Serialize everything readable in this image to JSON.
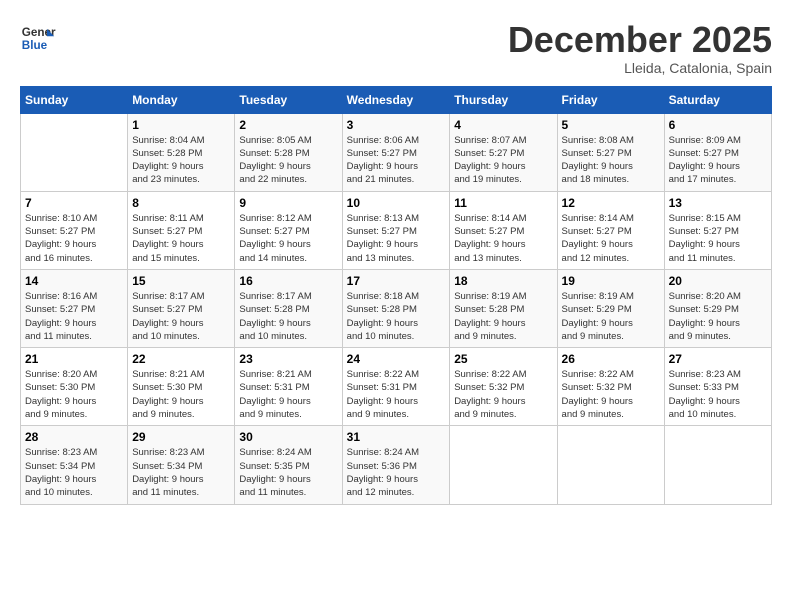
{
  "header": {
    "logo_line1": "General",
    "logo_line2": "Blue",
    "month": "December 2025",
    "location": "Lleida, Catalonia, Spain"
  },
  "weekdays": [
    "Sunday",
    "Monday",
    "Tuesday",
    "Wednesday",
    "Thursday",
    "Friday",
    "Saturday"
  ],
  "weeks": [
    [
      {
        "day": "",
        "info": ""
      },
      {
        "day": "1",
        "info": "Sunrise: 8:04 AM\nSunset: 5:28 PM\nDaylight: 9 hours\nand 23 minutes."
      },
      {
        "day": "2",
        "info": "Sunrise: 8:05 AM\nSunset: 5:28 PM\nDaylight: 9 hours\nand 22 minutes."
      },
      {
        "day": "3",
        "info": "Sunrise: 8:06 AM\nSunset: 5:27 PM\nDaylight: 9 hours\nand 21 minutes."
      },
      {
        "day": "4",
        "info": "Sunrise: 8:07 AM\nSunset: 5:27 PM\nDaylight: 9 hours\nand 19 minutes."
      },
      {
        "day": "5",
        "info": "Sunrise: 8:08 AM\nSunset: 5:27 PM\nDaylight: 9 hours\nand 18 minutes."
      },
      {
        "day": "6",
        "info": "Sunrise: 8:09 AM\nSunset: 5:27 PM\nDaylight: 9 hours\nand 17 minutes."
      }
    ],
    [
      {
        "day": "7",
        "info": "Sunrise: 8:10 AM\nSunset: 5:27 PM\nDaylight: 9 hours\nand 16 minutes."
      },
      {
        "day": "8",
        "info": "Sunrise: 8:11 AM\nSunset: 5:27 PM\nDaylight: 9 hours\nand 15 minutes."
      },
      {
        "day": "9",
        "info": "Sunrise: 8:12 AM\nSunset: 5:27 PM\nDaylight: 9 hours\nand 14 minutes."
      },
      {
        "day": "10",
        "info": "Sunrise: 8:13 AM\nSunset: 5:27 PM\nDaylight: 9 hours\nand 13 minutes."
      },
      {
        "day": "11",
        "info": "Sunrise: 8:14 AM\nSunset: 5:27 PM\nDaylight: 9 hours\nand 13 minutes."
      },
      {
        "day": "12",
        "info": "Sunrise: 8:14 AM\nSunset: 5:27 PM\nDaylight: 9 hours\nand 12 minutes."
      },
      {
        "day": "13",
        "info": "Sunrise: 8:15 AM\nSunset: 5:27 PM\nDaylight: 9 hours\nand 11 minutes."
      }
    ],
    [
      {
        "day": "14",
        "info": "Sunrise: 8:16 AM\nSunset: 5:27 PM\nDaylight: 9 hours\nand 11 minutes."
      },
      {
        "day": "15",
        "info": "Sunrise: 8:17 AM\nSunset: 5:27 PM\nDaylight: 9 hours\nand 10 minutes."
      },
      {
        "day": "16",
        "info": "Sunrise: 8:17 AM\nSunset: 5:28 PM\nDaylight: 9 hours\nand 10 minutes."
      },
      {
        "day": "17",
        "info": "Sunrise: 8:18 AM\nSunset: 5:28 PM\nDaylight: 9 hours\nand 10 minutes."
      },
      {
        "day": "18",
        "info": "Sunrise: 8:19 AM\nSunset: 5:28 PM\nDaylight: 9 hours\nand 9 minutes."
      },
      {
        "day": "19",
        "info": "Sunrise: 8:19 AM\nSunset: 5:29 PM\nDaylight: 9 hours\nand 9 minutes."
      },
      {
        "day": "20",
        "info": "Sunrise: 8:20 AM\nSunset: 5:29 PM\nDaylight: 9 hours\nand 9 minutes."
      }
    ],
    [
      {
        "day": "21",
        "info": "Sunrise: 8:20 AM\nSunset: 5:30 PM\nDaylight: 9 hours\nand 9 minutes."
      },
      {
        "day": "22",
        "info": "Sunrise: 8:21 AM\nSunset: 5:30 PM\nDaylight: 9 hours\nand 9 minutes."
      },
      {
        "day": "23",
        "info": "Sunrise: 8:21 AM\nSunset: 5:31 PM\nDaylight: 9 hours\nand 9 minutes."
      },
      {
        "day": "24",
        "info": "Sunrise: 8:22 AM\nSunset: 5:31 PM\nDaylight: 9 hours\nand 9 minutes."
      },
      {
        "day": "25",
        "info": "Sunrise: 8:22 AM\nSunset: 5:32 PM\nDaylight: 9 hours\nand 9 minutes."
      },
      {
        "day": "26",
        "info": "Sunrise: 8:22 AM\nSunset: 5:32 PM\nDaylight: 9 hours\nand 9 minutes."
      },
      {
        "day": "27",
        "info": "Sunrise: 8:23 AM\nSunset: 5:33 PM\nDaylight: 9 hours\nand 10 minutes."
      }
    ],
    [
      {
        "day": "28",
        "info": "Sunrise: 8:23 AM\nSunset: 5:34 PM\nDaylight: 9 hours\nand 10 minutes."
      },
      {
        "day": "29",
        "info": "Sunrise: 8:23 AM\nSunset: 5:34 PM\nDaylight: 9 hours\nand 11 minutes."
      },
      {
        "day": "30",
        "info": "Sunrise: 8:24 AM\nSunset: 5:35 PM\nDaylight: 9 hours\nand 11 minutes."
      },
      {
        "day": "31",
        "info": "Sunrise: 8:24 AM\nSunset: 5:36 PM\nDaylight: 9 hours\nand 12 minutes."
      },
      {
        "day": "",
        "info": ""
      },
      {
        "day": "",
        "info": ""
      },
      {
        "day": "",
        "info": ""
      }
    ]
  ]
}
